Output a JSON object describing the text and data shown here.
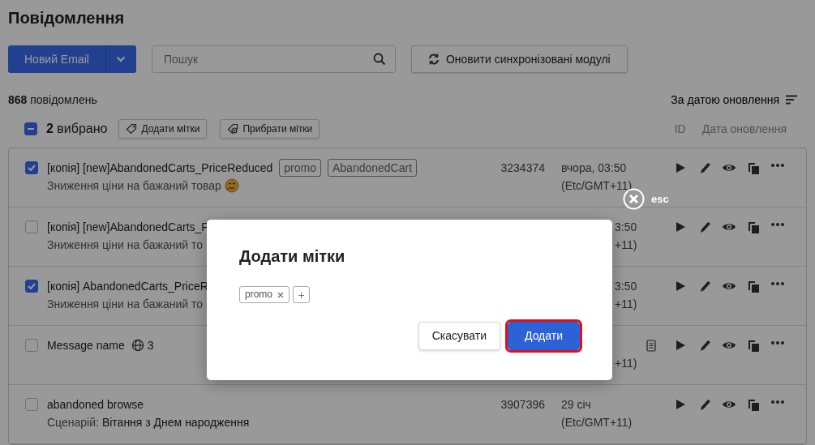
{
  "title": "Повідомлення",
  "toolbar": {
    "new_button": "Новий Email",
    "search": {
      "placeholder": "Пошук"
    },
    "sync_button": "Оновити синхронізовані модулі"
  },
  "summary": {
    "count": "**868** повідомлень",
    "sort": "За датою оновлення"
  },
  "selection": {
    "indeterminate": true,
    "label": "**2** вибрано",
    "actions": [
      {
        "label": "Додати мітки",
        "kind": "add"
      },
      {
        "label": "Прибрати мітки",
        "kind": "remove"
      }
    ]
  },
  "columns": [
    "ID",
    "Дата оновлення"
  ],
  "rows": [
    {
      "checked": true,
      "covered": false,
      "name": "[копія] [new]AbandonedCarts_PriceReduced",
      "tags": [
        "promo",
        "AbandonedCart"
      ],
      "subtitle": "Зниження ціни на бажаний товар",
      "emoji": true,
      "id": "3234374",
      "date": {
        "line1": "вчора, 03:50",
        "line2": "(Etc/GMT+11)"
      }
    },
    {
      "checked": false,
      "covered": true,
      "name": "[копія] [new]AbandonedCarts_P",
      "subtitle": "Зниження ціни на бажаний то",
      "date": {
        "line1": "3:50",
        "line2": "+11)"
      }
    },
    {
      "checked": true,
      "covered": true,
      "name": "[копія] AbandonedCarts_PriceR",
      "subtitle": "Зниження ціни на бажаний то",
      "date": {
        "line1": "3:50",
        "line2": "+11)"
      }
    },
    {
      "checked": false,
      "covered": true,
      "name": "Message name",
      "locales": "3",
      "note": true,
      "date": {
        "line2": "+11)"
      }
    },
    {
      "checked": false,
      "covered": false,
      "name": "abandoned browse",
      "scenario": {
        "label": "Сценарій:",
        "value": "Вітання з Днем народження"
      },
      "id": "3907396",
      "date": {
        "line1": "29 січ",
        "line2": "(Etc/GMT+11)"
      }
    }
  ],
  "close": {
    "label": "esc"
  },
  "dialog": {
    "title": "Додати мітки",
    "tags": [
      "promo"
    ],
    "add_tag": "+",
    "buttons": [
      {
        "label": "Скасувати",
        "kind": "secondary",
        "focused": false
      },
      {
        "label": "Додати",
        "kind": "primary",
        "focused": true
      }
    ]
  }
}
